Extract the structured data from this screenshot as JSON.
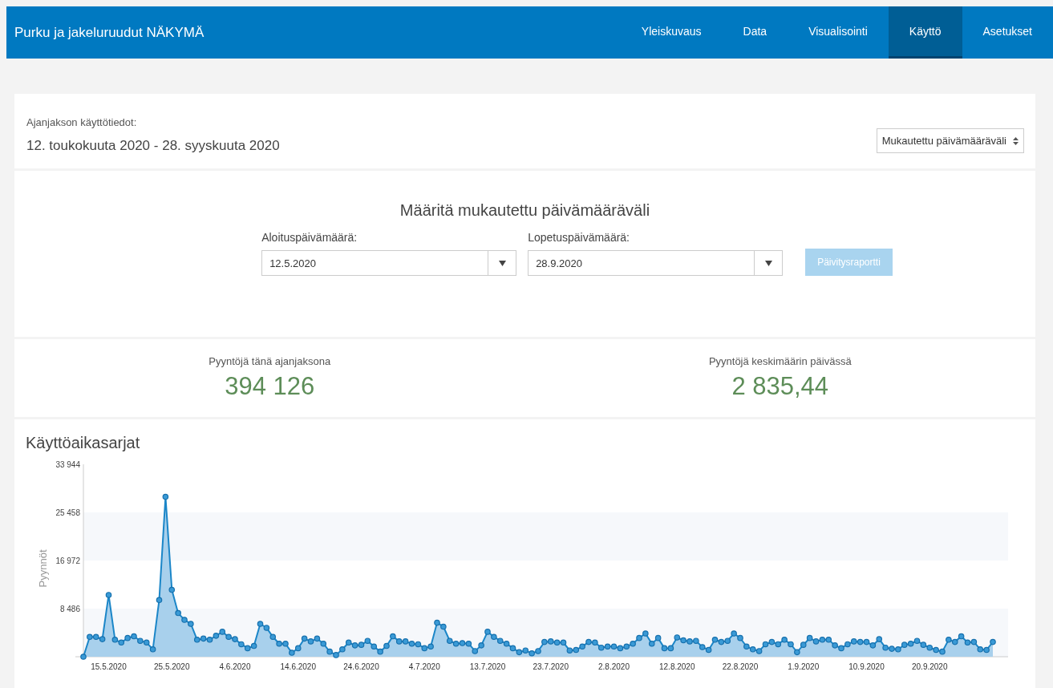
{
  "header": {
    "title": "Purku ja jakeluruudut NÄKYMÄ",
    "tabs": [
      {
        "label": "Yleiskuvaus",
        "selected": false
      },
      {
        "label": "Data",
        "selected": false
      },
      {
        "label": "Visualisointi",
        "selected": false
      },
      {
        "label": "Käyttö",
        "selected": true
      },
      {
        "label": "Asetukset",
        "selected": false
      }
    ]
  },
  "period": {
    "label": "Ajanjakson käyttötiedot:",
    "range": "12. toukokuuta 2020 - 28. syyskuuta 2020",
    "select": "Mukautettu päivämääräväli"
  },
  "custom_range": {
    "title": "Määritä mukautettu päivämääräväli",
    "fields": [
      {
        "label": "Aloituspäivämäärä:",
        "value": "12.5.2020"
      },
      {
        "label": "Lopetuspäivämäärä:",
        "value": "28.9.2020"
      }
    ],
    "button": {
      "label": "Päivitysraportti",
      "disabled": true
    }
  },
  "stats": [
    {
      "label": "Pyyntöjä tänä ajanjaksona",
      "value": "394 126"
    },
    {
      "label": "Pyyntöjä keskimäärin päivässä",
      "value": "2 835,44"
    }
  ],
  "timeseries": {
    "title": "Käyttöaikasarjat",
    "chart_data": {
      "type": "area",
      "ylabel": "Pyynnöt",
      "ylim": [
        0,
        33944
      ],
      "bands": [
        {
          "axis": "y",
          "from": 0,
          "to": 8486
        },
        {
          "axis": "y",
          "from": 16972,
          "to": 25458
        }
      ],
      "categories": [
        null,
        null,
        null,
        null,
        "15.5.2020",
        null,
        null,
        null,
        null,
        null,
        null,
        null,
        null,
        null,
        "25.5.2020",
        null,
        null,
        null,
        null,
        null,
        null,
        null,
        null,
        null,
        "4.6.2020",
        null,
        null,
        null,
        null,
        null,
        null,
        null,
        null,
        null,
        "14.6.2020",
        null,
        null,
        null,
        null,
        null,
        null,
        null,
        null,
        null,
        "24.6.2020",
        null,
        null,
        null,
        null,
        null,
        null,
        null,
        null,
        null,
        "4.7.2020",
        null,
        null,
        null,
        null,
        null,
        null,
        null,
        null,
        null,
        "13.7.2020",
        null,
        null,
        null,
        null,
        null,
        null,
        null,
        null,
        null,
        "23.7.2020",
        null,
        null,
        null,
        null,
        null,
        null,
        null,
        null,
        null,
        "2.8.2020",
        null,
        null,
        null,
        null,
        null,
        null,
        null,
        null,
        null,
        "12.8.2020",
        null,
        null,
        null,
        null,
        null,
        null,
        null,
        null,
        null,
        "22.8.2020",
        null,
        null,
        null,
        null,
        null,
        null,
        null,
        null,
        null,
        "1.9.2020",
        null,
        null,
        null,
        null,
        null,
        null,
        null,
        null,
        null,
        "10.9.2020",
        null,
        null,
        null,
        null,
        null,
        null,
        null,
        null,
        null,
        "20.9.2020",
        null,
        null,
        null,
        null,
        null,
        null,
        null,
        null,
        null,
        null
      ],
      "yticks": [
        {
          "value": 8486,
          "label": "8 486"
        },
        {
          "value": 16972,
          "label": "16 972"
        },
        {
          "value": 25458,
          "label": "25 458"
        },
        {
          "value": 33944,
          "label": "33 944"
        }
      ],
      "values": [
        0,
        3500,
        3500,
        3100,
        10900,
        3000,
        2500,
        3300,
        3600,
        2800,
        2500,
        1300,
        10000,
        28200,
        11800,
        7700,
        6500,
        5800,
        3000,
        3200,
        3000,
        3700,
        4400,
        3500,
        3100,
        2200,
        1500,
        1900,
        5800,
        5100,
        3500,
        2300,
        2300,
        700,
        1500,
        3200,
        2700,
        3200,
        2300,
        900,
        300,
        1300,
        2500,
        2000,
        2100,
        2800,
        1800,
        900,
        1900,
        3600,
        2700,
        2700,
        2300,
        2200,
        1500,
        1800,
        6000,
        5300,
        2800,
        2300,
        2400,
        2300,
        1000,
        2000,
        4400,
        3500,
        2800,
        2300,
        1500,
        800,
        1100,
        600,
        1000,
        2600,
        2700,
        2500,
        2500,
        1100,
        1200,
        1800,
        2600,
        2500,
        1600,
        1800,
        1800,
        1500,
        1800,
        2300,
        3300,
        4100,
        2300,
        3300,
        1500,
        1500,
        3400,
        2900,
        2700,
        2800,
        1700,
        1200,
        3000,
        2600,
        2800,
        4100,
        3300,
        1800,
        1300,
        1000,
        2200,
        2600,
        2200,
        3000,
        2200,
        800,
        2100,
        3300,
        2700,
        3000,
        3000,
        2000,
        1500,
        2200,
        2700,
        2600,
        2600,
        2000,
        3100,
        1600,
        1400,
        1300,
        2100,
        2300,
        2800,
        2100,
        1600,
        1200,
        900,
        3000,
        2600,
        3600,
        2500,
        2600,
        1300,
        1200,
        2600
      ]
    }
  }
}
